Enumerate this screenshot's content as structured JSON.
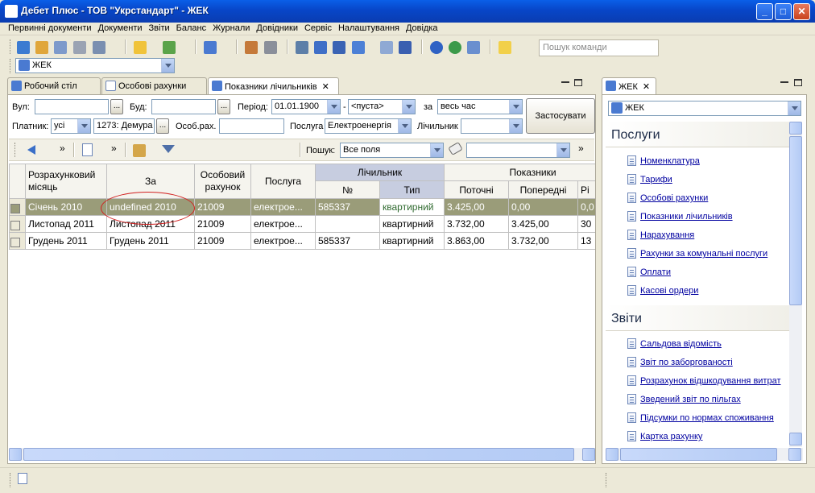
{
  "window": {
    "title": "Дебет Плюс - ТОВ \"Укрстандарт\" - ЖЕК",
    "min": "_",
    "max": "□",
    "close": "✕"
  },
  "menu": [
    "Первинні документи",
    "Документи",
    "Звіти",
    "Баланс",
    "Журнали",
    "Довідники",
    "Сервіс",
    "Налаштування",
    "Довідка"
  ],
  "command_box": {
    "placeholder": "Пошук команди"
  },
  "org_combo": "ЖЕК",
  "tabs": [
    {
      "label": "Робочий стіл"
    },
    {
      "label": "Особові рахунки"
    },
    {
      "label": "Показники лічильників",
      "close": "✕"
    }
  ],
  "filters": {
    "vul_label": "Вул:",
    "bud_label": "Буд:",
    "period_label": "Період:",
    "period_from": "01.01.1900",
    "dash": "-",
    "period_to": "<пуста>",
    "za_label": "за",
    "za_value": "весь час",
    "apply": "Застосувати",
    "payer_label": "Платник:",
    "payer_value": "усі",
    "payer_code": "1273: Демура",
    "osob_label": "Особ.рах.",
    "posluga_label": "Послуга",
    "posluga_value": "Електроенергія",
    "lich_label": "Лічильник",
    "dots": "..."
  },
  "grid_toolbar": {
    "chevron": "»",
    "search_label": "Пошук:",
    "search_field": "Все поля"
  },
  "grid": {
    "headers": {
      "month": "Розрахунковий місяць",
      "za": "За",
      "account": "Особовий рахунок",
      "service": "Послуга",
      "meter": "Лічильник",
      "num": "№",
      "type": "Тип",
      "readings": "Показники",
      "current": "Поточні",
      "previous": "Попередні",
      "diff": "Рі"
    },
    "rows": [
      {
        "month": "Січень 2010",
        "za": "undefined 2010",
        "account": "21009",
        "service": "електрое...",
        "num": "585337",
        "type": "квартирний",
        "current": "3.425,00",
        "previous": "0,00",
        "diff": "0,0"
      },
      {
        "month": "Листопад 2011",
        "za": "Листопад 2011",
        "account": "21009",
        "service": "електрое...",
        "num": "",
        "type": "квартирний",
        "current": "3.732,00",
        "previous": "3.425,00",
        "diff": "30"
      },
      {
        "month": "Грудень 2011",
        "za": "Грудень 2011",
        "account": "21009",
        "service": "електрое...",
        "num": "585337",
        "type": "квартирний",
        "current": "3.863,00",
        "previous": "3.732,00",
        "diff": "13"
      }
    ]
  },
  "right_panel": {
    "tab": "ЖЕК",
    "tab_close": "✕",
    "combo": "ЖЕК",
    "sections": [
      {
        "title": "Послуги",
        "links": [
          "Номенклатура",
          "Тарифи",
          "Особові рахунки",
          "Показники лічильників",
          "Нарахування",
          "Рахунки за комунальні послуги",
          "Оплати",
          "Касові ордери"
        ]
      },
      {
        "title": "Звіти",
        "links": [
          "Сальдова відомість",
          "Звіт по заборгованості",
          "Розрахунок відшкодування витрат",
          "Зведений звіт по пільгах",
          "Підсумки по нормах споживання",
          "Картка рахунку"
        ]
      }
    ]
  }
}
